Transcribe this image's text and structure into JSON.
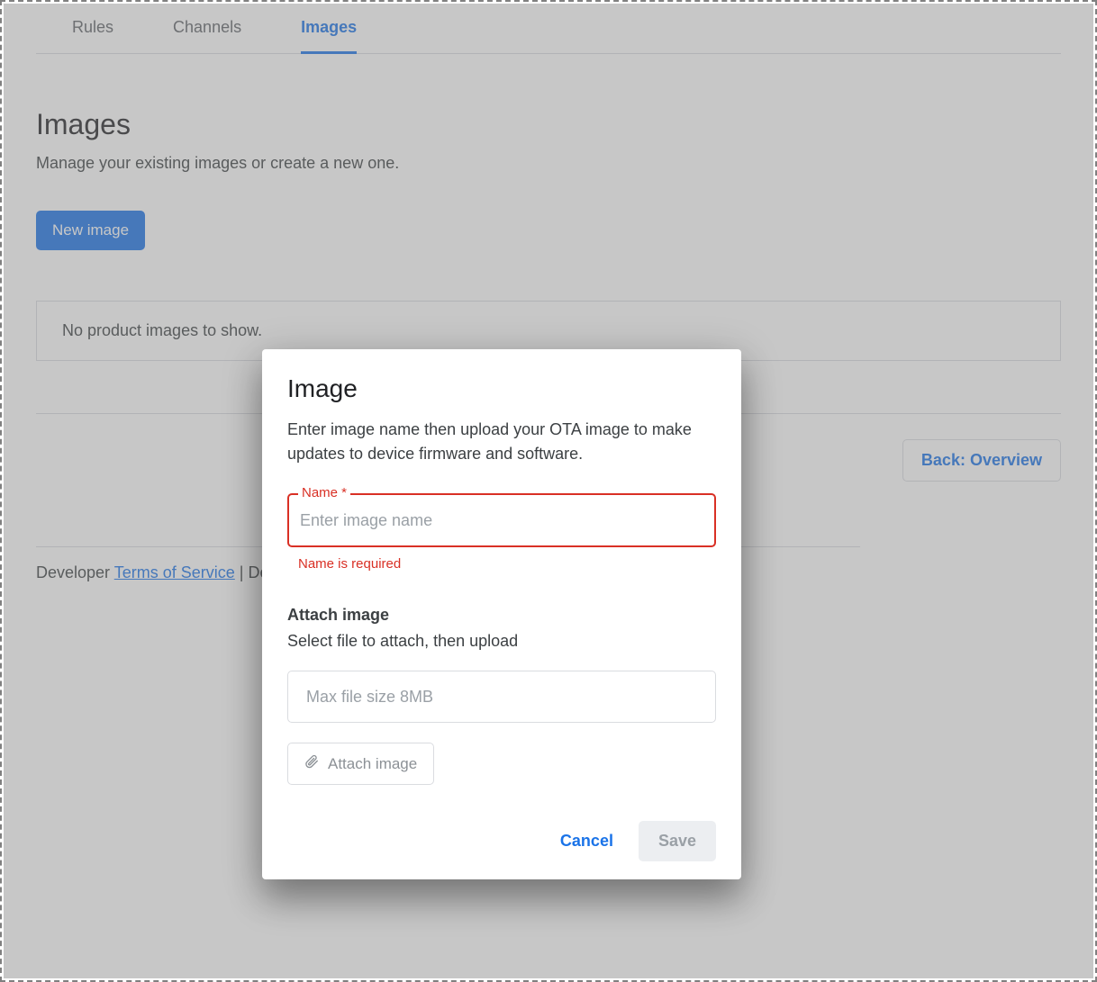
{
  "tabs": [
    {
      "label": "Rules",
      "active": false
    },
    {
      "label": "Channels",
      "active": false
    },
    {
      "label": "Images",
      "active": true
    }
  ],
  "page": {
    "title": "Images",
    "subtitle": "Manage your existing images or create a new one.",
    "new_button": "New image",
    "empty": "No product images to show.",
    "back_button": "Back: Overview"
  },
  "footer": {
    "prefix": "Developer ",
    "tos": "Terms of Service",
    "sep_devs": " | Devs"
  },
  "dialog": {
    "title": "Image",
    "desc": "Enter image name then upload your OTA image to make updates to device firmware and software.",
    "name_label": "Name *",
    "name_placeholder": "Enter image name",
    "name_value": "",
    "name_error": "Name is required",
    "attach_title": "Attach image",
    "attach_sub": "Select file to attach, then upload",
    "file_hint": "Max file size 8MB",
    "attach_button": "Attach image",
    "cancel": "Cancel",
    "save": "Save"
  }
}
